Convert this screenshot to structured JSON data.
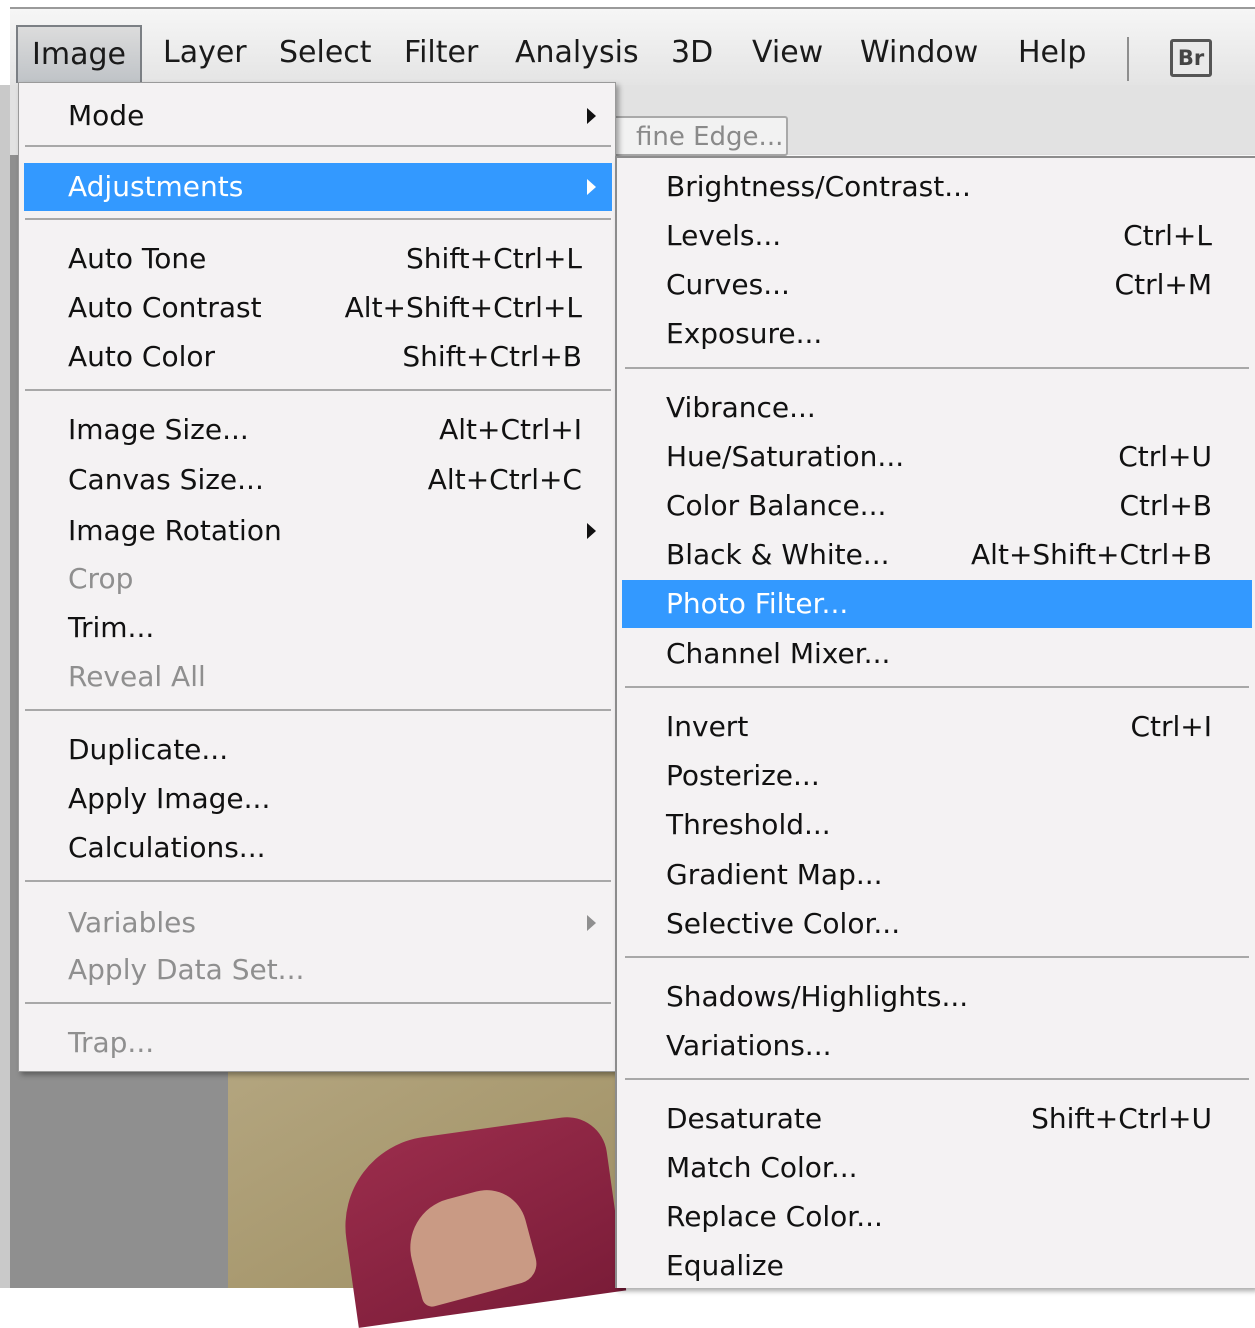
{
  "menubar": {
    "items": [
      "Image",
      "Layer",
      "Select",
      "Filter",
      "Analysis",
      "3D",
      "View",
      "Window",
      "Help"
    ],
    "bridge_label": "Br"
  },
  "options_bar": {
    "refine_edge_partial": "fine Edge..."
  },
  "image_menu": {
    "mode": "Mode",
    "adjustments": "Adjustments",
    "auto_tone": {
      "label": "Auto Tone",
      "shortcut": "Shift+Ctrl+L"
    },
    "auto_contrast": {
      "label": "Auto Contrast",
      "shortcut": "Alt+Shift+Ctrl+L"
    },
    "auto_color": {
      "label": "Auto Color",
      "shortcut": "Shift+Ctrl+B"
    },
    "image_size": {
      "label": "Image Size...",
      "shortcut": "Alt+Ctrl+I"
    },
    "canvas_size": {
      "label": "Canvas Size...",
      "shortcut": "Alt+Ctrl+C"
    },
    "image_rotation": "Image Rotation",
    "crop": "Crop",
    "trim": "Trim...",
    "reveal_all": "Reveal All",
    "duplicate": "Duplicate...",
    "apply_image": "Apply Image...",
    "calculations": "Calculations...",
    "variables": "Variables",
    "apply_data_set": "Apply Data Set...",
    "trap": "Trap..."
  },
  "adjustments_menu": {
    "brightness_contrast": {
      "label": "Brightness/Contrast..."
    },
    "levels": {
      "label": "Levels...",
      "shortcut": "Ctrl+L"
    },
    "curves": {
      "label": "Curves...",
      "shortcut": "Ctrl+M"
    },
    "exposure": {
      "label": "Exposure..."
    },
    "vibrance": {
      "label": "Vibrance..."
    },
    "hue_saturation": {
      "label": "Hue/Saturation...",
      "shortcut": "Ctrl+U"
    },
    "color_balance": {
      "label": "Color Balance...",
      "shortcut": "Ctrl+B"
    },
    "black_white": {
      "label": "Black & White...",
      "shortcut": "Alt+Shift+Ctrl+B"
    },
    "photo_filter": {
      "label": "Photo Filter..."
    },
    "channel_mixer": {
      "label": "Channel Mixer..."
    },
    "invert": {
      "label": "Invert",
      "shortcut": "Ctrl+I"
    },
    "posterize": {
      "label": "Posterize..."
    },
    "threshold": {
      "label": "Threshold..."
    },
    "gradient_map": {
      "label": "Gradient Map..."
    },
    "selective_color": {
      "label": "Selective Color..."
    },
    "shadows_highlights": {
      "label": "Shadows/Highlights..."
    },
    "variations": {
      "label": "Variations..."
    },
    "desaturate": {
      "label": "Desaturate",
      "shortcut": "Shift+Ctrl+U"
    },
    "match_color": {
      "label": "Match Color..."
    },
    "replace_color": {
      "label": "Replace Color..."
    },
    "equalize": {
      "label": "Equalize"
    }
  },
  "colors": {
    "highlight": "#3399ff",
    "menu_background": "#f4f2f3",
    "disabled_text": "#8f8f8f"
  }
}
